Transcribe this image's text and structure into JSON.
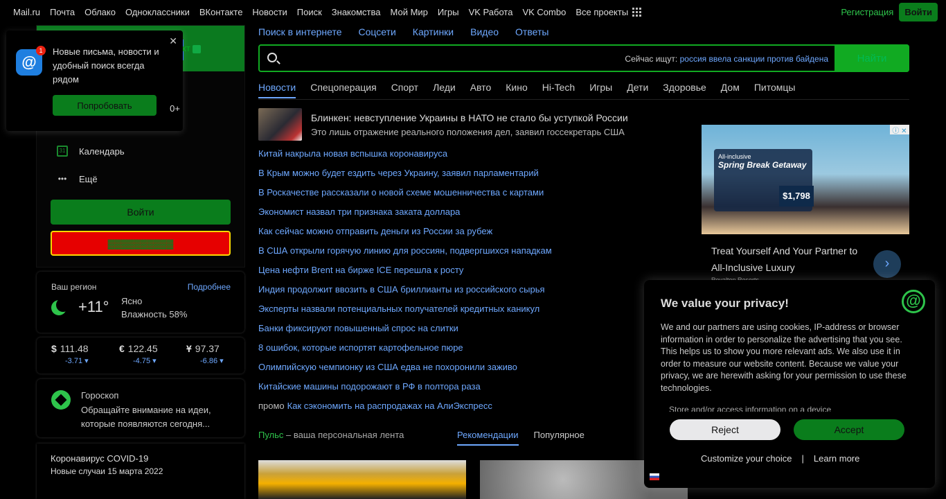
{
  "topbar": {
    "links": [
      "Mail.ru",
      "Почта",
      "Облако",
      "Одноклассники",
      "ВКонтакте",
      "Новости",
      "Поиск",
      "Знакомства",
      "Мой Мир",
      "Игры",
      "VK Работа",
      "VK Combo",
      "Все проекты"
    ],
    "register": "Регистрация",
    "login": "Войти"
  },
  "popup": {
    "text": "Новые письма, новости и удобный поиск всегда рядом",
    "badge": "1",
    "button": "Попробовать",
    "count": "0+"
  },
  "mail": {
    "menu": [
      {
        "label": "Календарь",
        "icon": "calendar-icon"
      },
      {
        "label": "Ещё",
        "icon": "more-icon"
      }
    ],
    "login_button": "Войти"
  },
  "weather": {
    "title": "Ваш регион",
    "more": "Подробнее",
    "temp": "+11°",
    "condition": "Ясно",
    "humidity": "Влажность 58%"
  },
  "rates": [
    {
      "symbol": "$",
      "value": "111.48",
      "delta": "-3.71 ▾"
    },
    {
      "symbol": "€",
      "value": "122.45",
      "delta": "-4.75 ▾"
    },
    {
      "symbol": "Ұ",
      "value": "97.37",
      "delta": "-6.86 ▾"
    }
  ],
  "horoscope": {
    "title": "Гороскоп",
    "text": "Обращайте внимание на идеи, которые появляются сегодня..."
  },
  "covid": {
    "title": "Коронавирус COVID-19",
    "subtitle": "Новые случаи 15 марта 2022"
  },
  "search": {
    "tabs": [
      "Поиск в интернете",
      "Соцсети",
      "Картинки",
      "Видео",
      "Ответы"
    ],
    "hint_prefix": "Сейчас ищут:",
    "hint_query": "россия ввела санкции против байдена",
    "button": "Найти"
  },
  "news": {
    "tabs": [
      "Новости",
      "Спецоперация",
      "Спорт",
      "Леди",
      "Авто",
      "Кино",
      "Hi-Tech",
      "Игры",
      "Дети",
      "Здоровье",
      "Дом",
      "Питомцы"
    ],
    "lead_title": "Блинкен: невступление Украины в НАТО не стало бы уступкой России",
    "lead_subtitle": "Это лишь отражение реального положения дел, заявил госсекретарь США",
    "items": [
      "Китай накрыла новая вспышка коронавируса",
      "В Крым можно будет ездить через Украину, заявил парламентарий",
      "В Роскачестве рассказали о новой схеме мошенничества с картами",
      "Экономист назвал три признака заката доллара",
      "Как сейчас можно отправить деньги из России за рубеж",
      "В США открыли горячую линию для россиян, подвергшихся нападкам",
      "Цена нефти Brent на бирже ICE перешла к росту",
      "Индия продолжит ввозить в США бриллианты из российского сырья",
      "Эксперты назвали потенциальных получателей кредитных каникул",
      "Банки фиксируют повышенный спрос на слитки",
      "8 ошибок, которые испортят картофельное пюре",
      "Олимпийскую чемпионку из США едва не похоронили заживо",
      "Китайские машины подорожают в РФ в полтора раза"
    ],
    "promo_label": "промо",
    "promo_text": "Как сэкономить на распродажах на АлиЭкспресс"
  },
  "pulse": {
    "brand": "Пульс",
    "tagline": " – ваша персональная лента",
    "tabs": [
      "Рекомендации",
      "Популярное"
    ]
  },
  "ad": {
    "promo_title": "Spring Break Getaway",
    "promo_sub": "All-inclusive",
    "price": "$1,798",
    "headline": "Treat Yourself And Your Partner to All-Inclusive Luxury",
    "source": "Royalton Resorts"
  },
  "privacy": {
    "title": "We value your privacy!",
    "body": "We and our partners are using cookies, IP-address or browser information in order to personalize the advertising that you see. This helps us to show you more relevant ads. We also use it in order to measure our website content. Because we value your privacy, we are herewith asking for your permission to use these technologies.",
    "sub": "Store and/or access information on a device",
    "reject": "Reject",
    "accept": "Accept",
    "customize": "Customize your choice",
    "learn_more": "Learn more"
  }
}
